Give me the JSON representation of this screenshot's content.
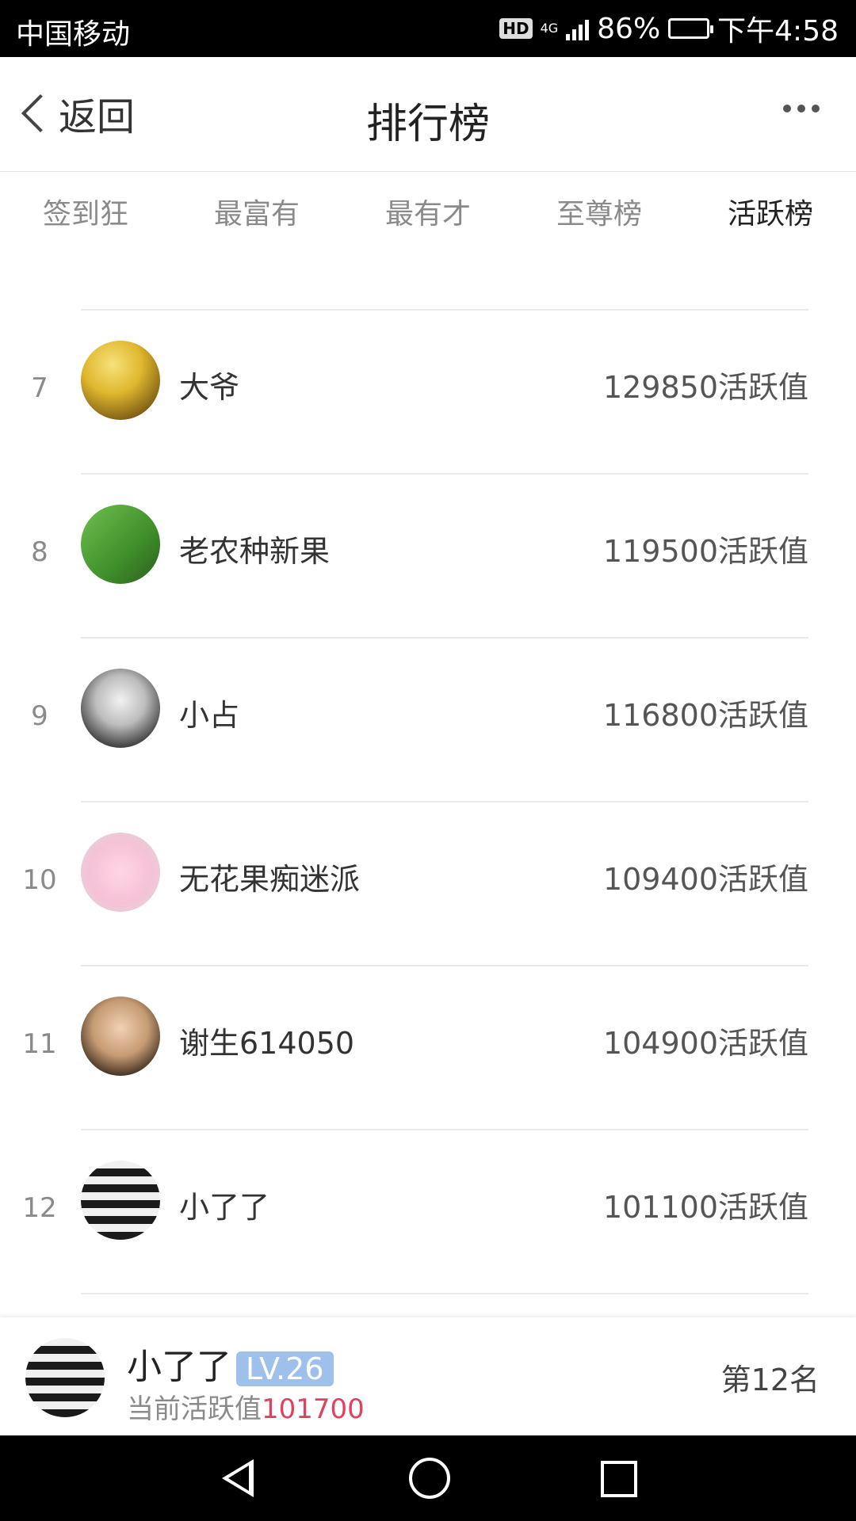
{
  "status_bar": {
    "carrier": "中国移动",
    "hd": "HD",
    "network": "4G",
    "battery": "86%",
    "time": "下午4:58"
  },
  "header": {
    "back_label": "返回",
    "title": "排行榜"
  },
  "tabs": [
    {
      "label": "签到狂",
      "active": false
    },
    {
      "label": "最富有",
      "active": false
    },
    {
      "label": "最有才",
      "active": false
    },
    {
      "label": "至尊榜",
      "active": false
    },
    {
      "label": "活跃榜",
      "active": true
    }
  ],
  "list": [
    {
      "rank": "7",
      "name": "大爷",
      "score": "129850活跃值"
    },
    {
      "rank": "8",
      "name": "老农种新果",
      "score": "119500活跃值"
    },
    {
      "rank": "9",
      "name": "小占",
      "score": "116800活跃值"
    },
    {
      "rank": "10",
      "name": "无花果痴迷派",
      "score": "109400活跃值"
    },
    {
      "rank": "11",
      "name": "谢生614050",
      "score": "104900活跃值"
    },
    {
      "rank": "12",
      "name": "小了了",
      "score": "101100活跃值"
    }
  ],
  "my_rank": {
    "name": "小了了",
    "level": "LV.26",
    "score_label": "当前活跃值",
    "score_value": "101700",
    "rank_text": "第12名"
  }
}
